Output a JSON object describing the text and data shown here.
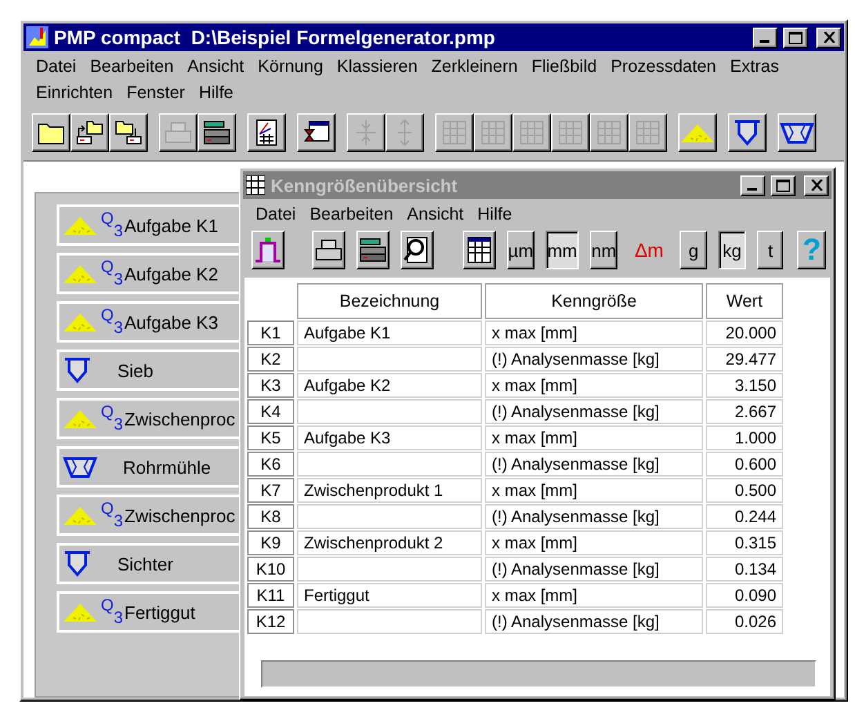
{
  "window": {
    "title": "PMP compact  D:\\Beispiel Formelgenerator.pmp"
  },
  "menu": [
    {
      "label": "Datei"
    },
    {
      "label": "Bearbeiten"
    },
    {
      "label": "Ansicht"
    },
    {
      "label": "Körnung"
    },
    {
      "label": "Klassieren"
    },
    {
      "label": "Zerkleinern"
    },
    {
      "label": "Fließbild"
    },
    {
      "label": "Prozessdaten"
    },
    {
      "label": "Extras"
    },
    {
      "label": "Einrichten"
    },
    {
      "label": "Fenster"
    },
    {
      "label": "Hilfe"
    }
  ],
  "toolbar": [
    [
      {
        "kind": "folder",
        "disabled": false
      },
      {
        "kind": "open",
        "disabled": false
      },
      {
        "kind": "save",
        "disabled": false
      }
    ],
    [
      {
        "kind": "printer",
        "disabled": true
      },
      {
        "kind": "printsetup",
        "disabled": false
      }
    ],
    [
      {
        "kind": "report",
        "disabled": false
      }
    ],
    [
      {
        "kind": "hourglass",
        "disabled": false
      }
    ],
    [
      {
        "kind": "collapse",
        "disabled": true
      },
      {
        "kind": "expand",
        "disabled": true
      }
    ],
    [
      {
        "kind": "grid",
        "disabled": true
      },
      {
        "kind": "grid",
        "disabled": true
      },
      {
        "kind": "grid",
        "disabled": true
      },
      {
        "kind": "grid",
        "disabled": true
      },
      {
        "kind": "grid",
        "disabled": true
      },
      {
        "kind": "grid",
        "disabled": true
      }
    ],
    [
      {
        "kind": "pile",
        "disabled": false
      }
    ],
    [
      {
        "kind": "sieve",
        "disabled": false
      }
    ],
    [
      {
        "kind": "mill",
        "disabled": false
      }
    ]
  ],
  "flowsheet": [
    {
      "kind": "pile",
      "mark": "Q$_{3}$",
      "label": "Aufgabe K1"
    },
    {
      "kind": "pile",
      "mark": "Q$_{3}$",
      "label": "Aufgabe K2"
    },
    {
      "kind": "pile",
      "mark": "Q$_{3}$",
      "label": "Aufgabe K3"
    },
    {
      "kind": "sieve",
      "label": "Sieb"
    },
    {
      "kind": "pile",
      "mark": "Q$_{3}$",
      "label": "Zwischenproc"
    },
    {
      "kind": "mill",
      "label": "Rohrmühle"
    },
    {
      "kind": "pile",
      "mark": "Q$_{3}$",
      "label": "Zwischenproc"
    },
    {
      "kind": "sieve",
      "label": "Sichter"
    },
    {
      "kind": "pile",
      "mark": "Q$_{3}$",
      "label": "Fertiggut"
    }
  ],
  "child": {
    "title": "Kenngrößenübersicht",
    "active": false,
    "menu": [
      {
        "label": "Datei"
      },
      {
        "label": "Bearbeiten"
      },
      {
        "label": "Ansicht"
      },
      {
        "label": "Hilfe"
      }
    ],
    "toolbar": [
      {
        "kind": "chart"
      },
      {
        "kind": "gap"
      },
      {
        "kind": "printer"
      },
      {
        "kind": "printsetup"
      },
      {
        "kind": "preview"
      },
      {
        "kind": "gap"
      },
      {
        "kind": "table"
      },
      {
        "kind": "unit",
        "label": "µm",
        "selected": false
      },
      {
        "kind": "unit",
        "label": "mm",
        "selected": true
      },
      {
        "kind": "unit",
        "label": "nm",
        "selected": false
      },
      {
        "kind": "label",
        "label": "Δm"
      },
      {
        "kind": "unit",
        "label": "g",
        "selected": false
      },
      {
        "kind": "unit",
        "label": "kg",
        "selected": true
      },
      {
        "kind": "unit",
        "label": "t",
        "selected": false
      },
      {
        "kind": "help",
        "label": "?"
      }
    ],
    "table": {
      "columns": [
        "Bezeichnung",
        "Kenngröße",
        "Wert"
      ],
      "rows": [
        {
          "id": "K1",
          "name": "Aufgabe K1",
          "param": "x max [mm]",
          "value": "20.000"
        },
        {
          "id": "K2",
          "param": "(!) Analysenmasse [kg]",
          "value": "29.477"
        },
        {
          "id": "K3",
          "name": "Aufgabe K2",
          "param": "x max [mm]",
          "value": "3.150"
        },
        {
          "id": "K4",
          "param": "(!) Analysenmasse [kg]",
          "value": "2.667"
        },
        {
          "id": "K5",
          "name": "Aufgabe K3",
          "param": "x max [mm]",
          "value": "1.000"
        },
        {
          "id": "K6",
          "param": "(!) Analysenmasse [kg]",
          "value": "0.600"
        },
        {
          "id": "K7",
          "name": "Zwischenprodukt 1",
          "param": "x max [mm]",
          "value": "0.500"
        },
        {
          "id": "K8",
          "param": "(!) Analysenmasse [kg]",
          "value": "0.244"
        },
        {
          "id": "K9",
          "name": "Zwischenprodukt 2",
          "param": "x max [mm]",
          "value": "0.315"
        },
        {
          "id": "K10",
          "param": "(!) Analysenmasse [kg]",
          "value": "0.134"
        },
        {
          "id": "K11",
          "name": "Fertiggut",
          "param": "x max [mm]",
          "value": "0.090"
        },
        {
          "id": "K12",
          "param": "(!) Analysenmasse [kg]",
          "value": "0.026"
        }
      ]
    }
  }
}
